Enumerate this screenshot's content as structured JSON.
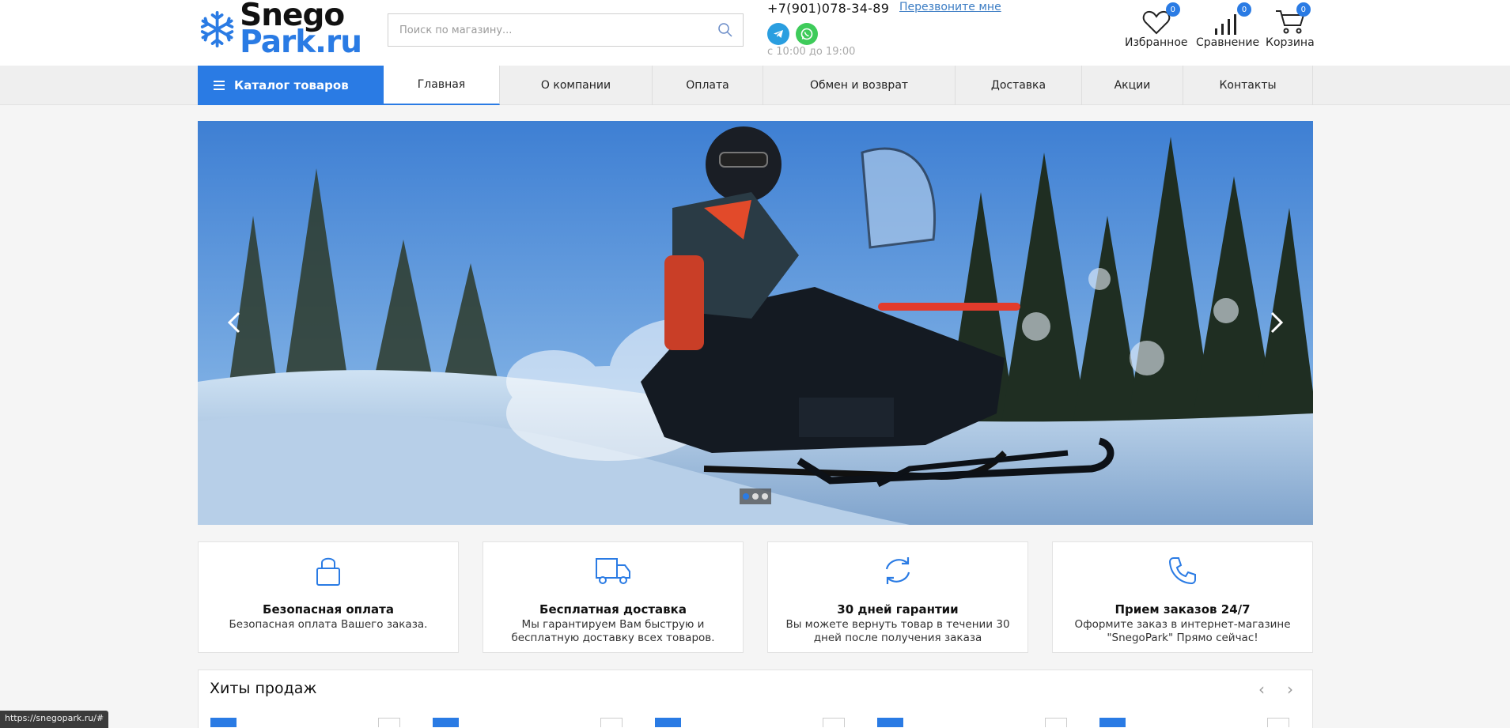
{
  "header": {
    "logo_line1": "Snego",
    "logo_line2": "Park.ru",
    "search_placeholder": "Поиск по магазину...",
    "phone": "+7(901)078-34-89",
    "callback_label": "Перезвоните мне",
    "hours": "с 10:00 до 19:00",
    "favorites": {
      "label": "Избранное",
      "count": "0"
    },
    "compare": {
      "label": "Сравнение",
      "count": "0"
    },
    "cart": {
      "label": "Корзина",
      "count": "0"
    }
  },
  "nav": {
    "catalog_label": "Каталог товаров",
    "items": [
      {
        "label": "Главная"
      },
      {
        "label": "О компании"
      },
      {
        "label": "Оплата"
      },
      {
        "label": "Обмен и возврат"
      },
      {
        "label": "Доставка"
      },
      {
        "label": "Акции"
      },
      {
        "label": "Контакты"
      }
    ]
  },
  "banner": {
    "slides_count": 3,
    "active_slide": 1
  },
  "features": [
    {
      "icon": "lock-icon",
      "title": "Безопасная оплата",
      "desc": "Безопасная оплата Вашего заказа."
    },
    {
      "icon": "truck-icon",
      "title": "Бесплатная доставка",
      "desc": "Мы гарантируем Вам быструю и бесплатную доставку всех товаров."
    },
    {
      "icon": "refresh-icon",
      "title": "30 дней гарантии",
      "desc": "Вы можете вернуть товар в течении 30 дней после получения заказа"
    },
    {
      "icon": "phone-icon",
      "title": "Прием заказов 24/7",
      "desc": "Оформите заказ в интернет-магазине \"SnegoPark\" Прямо сейчас!"
    }
  ],
  "hits": {
    "title": "Хиты продаж"
  },
  "status_url": "https://snegopark.ru/#",
  "colors": {
    "accent": "#2a7be4",
    "telegram": "#2a9ee0",
    "whatsapp": "#3ecb5a"
  }
}
